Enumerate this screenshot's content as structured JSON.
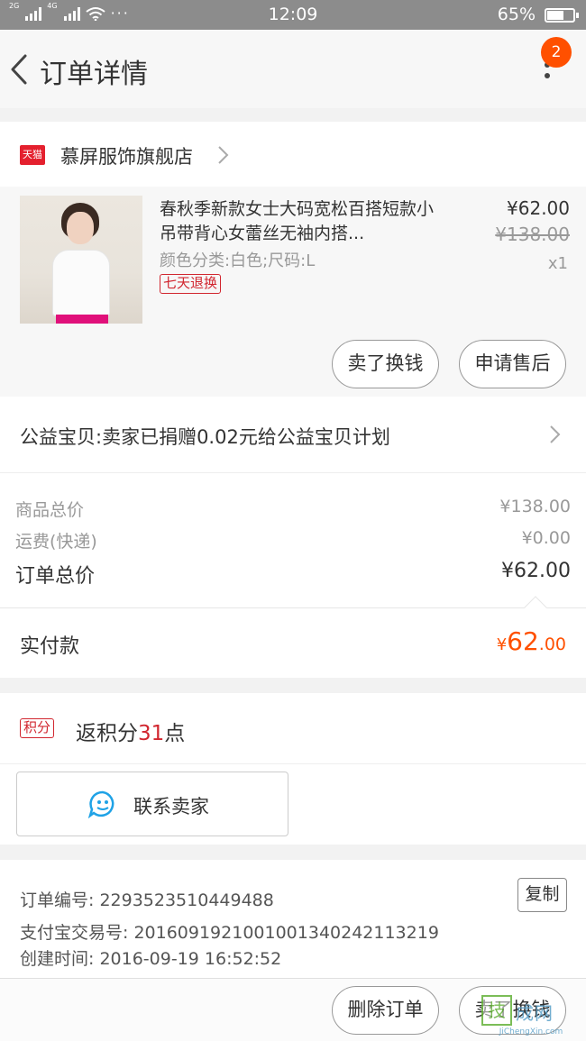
{
  "status_bar": {
    "sim1_label": "2G",
    "sim2_label": "4G",
    "dots": "···",
    "time": "12:09",
    "battery_percent": "65%",
    "battery_level": 0.65
  },
  "nav": {
    "title": "订单详情",
    "badge_count": "2",
    "badge_color": "#ff5000"
  },
  "shop": {
    "brand_tag": "天猫",
    "name": "慕屏服饰旗舰店"
  },
  "product": {
    "title": "春秋季新款女士大码宽松百搭短款小吊带背心女蕾丝无袖内搭...",
    "sku": "颜色分类:白色;尺码:L",
    "return_tag": "七天退换",
    "price": "¥62.00",
    "original_price": "¥138.00",
    "quantity": "x1",
    "sell_button": "卖了换钱",
    "after_sale_button": "申请售后"
  },
  "charity": {
    "text": "公益宝贝:卖家已捐赠0.02元给公益宝贝计划"
  },
  "totals": {
    "goods_total_label": "商品总价",
    "goods_total_value": "¥138.00",
    "shipping_label": "运费(快递)",
    "shipping_value": "¥0.00",
    "order_total_label": "订单总价",
    "order_total_value": "¥62.00"
  },
  "payment": {
    "label": "实付款",
    "currency": "¥",
    "amount_int": "62",
    "amount_dec": ".00",
    "accent_color": "#ff5000"
  },
  "points": {
    "tag": "积分",
    "prefix": "返积分",
    "count": "31",
    "suffix": "点"
  },
  "contact": {
    "label": "联系卖家",
    "icon": "chat-bubble-icon"
  },
  "order_info": {
    "order_no": "订单编号: 2293523510449488",
    "alipay_no": "支付宝交易号: 2016091921001001340242113219",
    "created": "创建时间: 2016-09-19 16:52:52",
    "copy_button": "复制"
  },
  "bottom_bar": {
    "delete_button": "删除订单",
    "sell_button": "卖了换钱"
  },
  "watermark": {
    "box_char": "技",
    "text": "成网",
    "domain": "JiChengXin.com"
  }
}
